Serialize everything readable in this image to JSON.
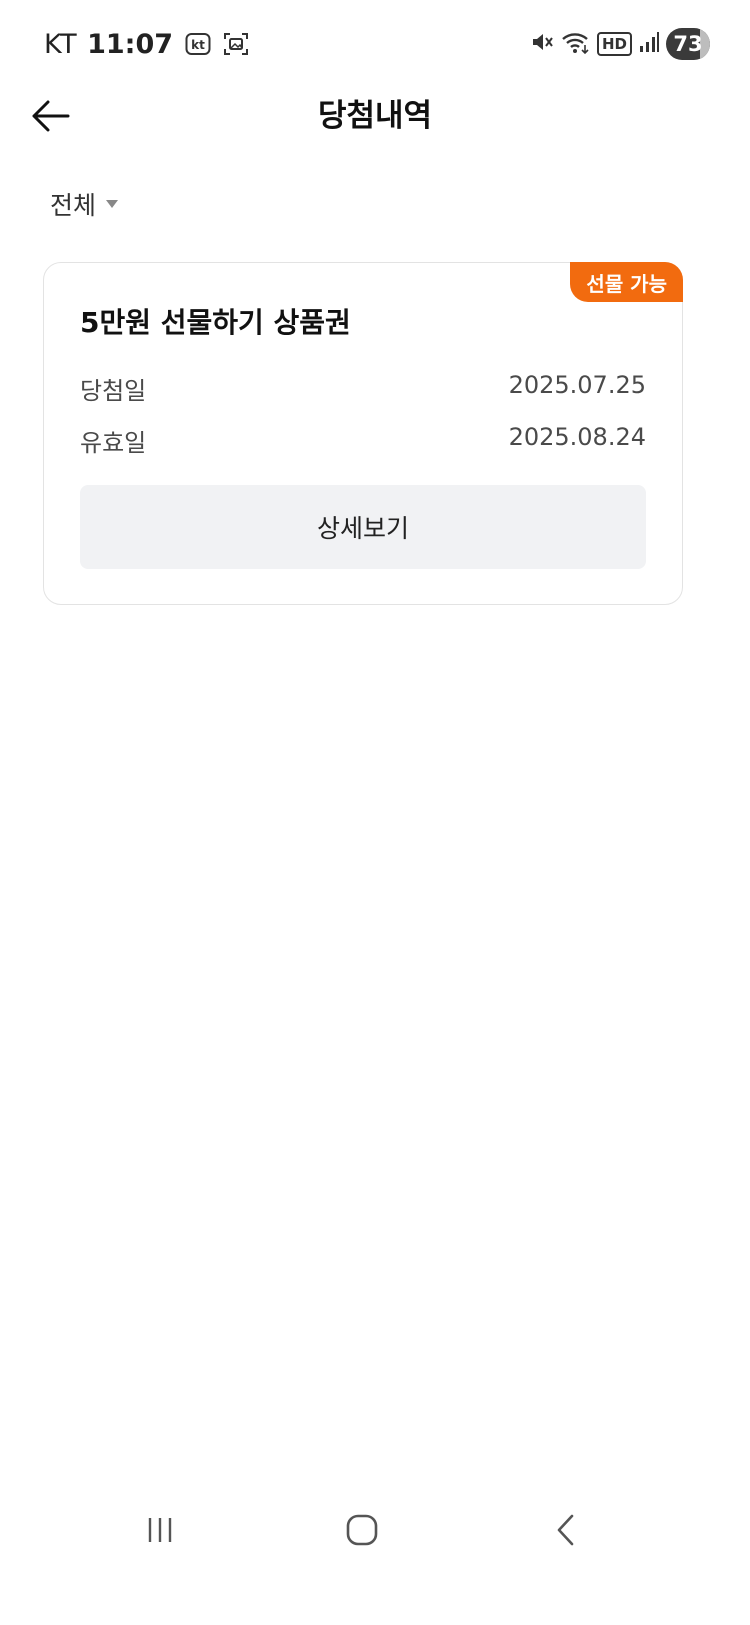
{
  "status_bar": {
    "carrier": "KT",
    "time": "11:07",
    "battery_level": "73",
    "network": "HD"
  },
  "header": {
    "title": "당첨내역"
  },
  "filter": {
    "selected": "전체"
  },
  "card": {
    "badge": "선물 가능",
    "title": "5만원 선물하기 상품권",
    "rows": [
      {
        "label": "당첨일",
        "value": "2025.07.25"
      },
      {
        "label": "유효일",
        "value": "2025.08.24"
      }
    ],
    "detail_button": "상세보기"
  },
  "colors": {
    "accent": "#f26b0f",
    "button_bg": "#f1f2f4",
    "border": "#e3e3e3"
  }
}
